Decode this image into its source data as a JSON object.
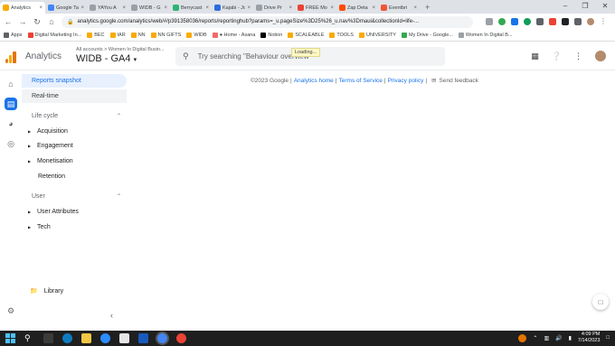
{
  "browser": {
    "tabs": [
      {
        "label": "Analytics",
        "color": "#f9ab00",
        "active": true
      },
      {
        "label": "Google Ta",
        "color": "#4285f4"
      },
      {
        "label": "YAYou A",
        "color": "#9aa0a6"
      },
      {
        "label": "WIDB - G",
        "color": "#9aa0a6"
      },
      {
        "label": "Berrycast",
        "color": "#2bb673"
      },
      {
        "label": "Kajabi - Jo",
        "color": "#2d6cdf"
      },
      {
        "label": "Drive Pr",
        "color": "#9aa0a6"
      },
      {
        "label": "FREE Mo",
        "color": "#ea4335"
      },
      {
        "label": "Zap Deta",
        "color": "#ff4a00"
      },
      {
        "label": "Eventbri",
        "color": "#f05537"
      }
    ],
    "url": "analytics.google.com/analytics/web/#/p391358036/reports/reportinghub?params=_u.pageSize%3D25%26_u.nav%3Dmaui&collectionId=life-...",
    "bookmarks": [
      {
        "label": "Apps",
        "color": "#5f6368"
      },
      {
        "label": "Digital Marketing In...",
        "color": "#ea4335"
      },
      {
        "label": "BEC",
        "color": "#f9ab00"
      },
      {
        "label": "IAR",
        "color": "#f9ab00"
      },
      {
        "label": "NN",
        "color": "#f9ab00"
      },
      {
        "label": "NN GIFTS",
        "color": "#f9ab00"
      },
      {
        "label": "WIDB",
        "color": "#f9ab00"
      },
      {
        "label": "● Home - Asana",
        "color": "#f06a6a"
      },
      {
        "label": "Notion",
        "color": "#000000"
      },
      {
        "label": "SCALEABLE",
        "color": "#f9ab00"
      },
      {
        "label": "TOOLS",
        "color": "#f9ab00"
      },
      {
        "label": "UNIVERSITY",
        "color": "#f9ab00"
      },
      {
        "label": "My Drive - Google...",
        "color": "#34a853"
      },
      {
        "label": "Women In Digital B...",
        "color": "#9aa0a6"
      }
    ]
  },
  "header": {
    "app_name": "Analytics",
    "breadcrumb": "All accounts > Women In Digital Busin...",
    "property": "WIDB - GA4",
    "search_placeholder": "Try searching \"Behaviour overview\"",
    "loading": "Loading..."
  },
  "nav": {
    "reports_snapshot": "Reports snapshot",
    "realtime": "Real-time",
    "lifecycle": {
      "title": "Life cycle",
      "items": [
        "Acquisition",
        "Engagement",
        "Monetisation",
        "Retention"
      ]
    },
    "user": {
      "title": "User",
      "items": [
        "User Attributes",
        "Tech"
      ]
    },
    "library": "Library"
  },
  "footer": {
    "copyright": "©2023 Google",
    "sep": "|",
    "analytics_home": "Analytics home",
    "terms": "Terms of Service",
    "privacy": "Privacy policy",
    "feedback": "Send feedback"
  },
  "taskbar": {
    "time": "4:09 PM",
    "date": "7/14/2023"
  }
}
